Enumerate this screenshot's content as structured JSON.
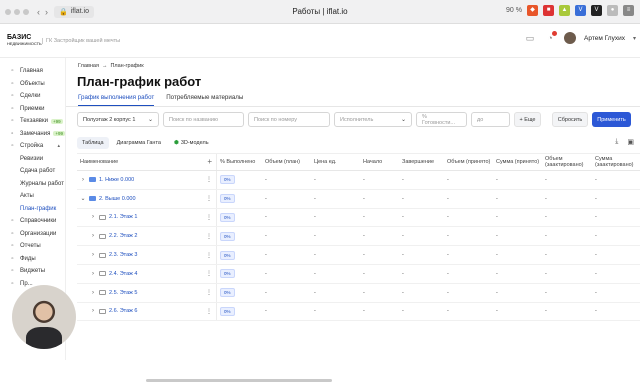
{
  "browser": {
    "url": "iflat.io",
    "window_title": "Работы | iflat.io",
    "zoom": "90 %"
  },
  "header": {
    "logo_main": "БАЗИС",
    "logo_sub": "НЕДВИЖИМОСТЬ",
    "tagline": "ГК Застройщик вашей мечты",
    "user_name": "Артем Глухих"
  },
  "sidebar": {
    "items": [
      {
        "label": "Главная",
        "icon": "home-icon"
      },
      {
        "label": "Объекты",
        "icon": "building-icon"
      },
      {
        "label": "Сделки",
        "icon": "deal-icon"
      },
      {
        "label": "Приемки",
        "icon": "clipboard-icon"
      },
      {
        "label": "Техзаявки",
        "icon": "wrench-icon",
        "badge": "+99"
      },
      {
        "label": "Замечания",
        "icon": "comment-icon",
        "badge": "+99"
      },
      {
        "label": "Стройка",
        "icon": "crane-icon",
        "expanded": true
      },
      {
        "label": "Ревизии",
        "sub": true
      },
      {
        "label": "Сдача работ",
        "sub": true
      },
      {
        "label": "Журналы работ",
        "sub": true
      },
      {
        "label": "Акты",
        "sub": true
      },
      {
        "label": "План-график",
        "sub": true,
        "active": true
      },
      {
        "label": "Справочники",
        "icon": "book-icon"
      },
      {
        "label": "Организации",
        "icon": "org-icon"
      },
      {
        "label": "Отчеты",
        "icon": "report-icon"
      },
      {
        "label": "Фиды",
        "icon": "feed-icon"
      },
      {
        "label": "Виджеты",
        "icon": "widget-icon"
      },
      {
        "label": "Пр...",
        "icon": "gear-icon"
      }
    ]
  },
  "main": {
    "breadcrumb": {
      "home": "Главная",
      "current": "План-график"
    },
    "title": "План-график работ",
    "tabs": [
      {
        "label": "График выполнения работ",
        "active": true
      },
      {
        "label": "Потребляемые материалы",
        "active": false
      }
    ],
    "filters": {
      "section_value": "Полуэтаж 2 корпус 1",
      "name_placeholder": "Поиск по названию",
      "number_placeholder": "Поиск по номеру",
      "executor_placeholder": "Исполнитель",
      "readiness_placeholder": "% Готовности...",
      "to_placeholder": "до",
      "more_label": "+ Еще",
      "reset_label": "Сбросить",
      "apply_label": "Применить"
    },
    "view_tabs": [
      {
        "label": "Таблица",
        "selected": true
      },
      {
        "label": "Диаграмма Ганта",
        "selected": false
      },
      {
        "label": "3D-модель",
        "selected": false
      }
    ],
    "table": {
      "columns": [
        "Наименование",
        "% Выполнено",
        "Объем (план)",
        "Цена ед.",
        "Начало",
        "Завершение",
        "Объем (принято)",
        "Сумма (принято)",
        "Объем (заактировано)",
        "Сумма (заактировано)"
      ],
      "rows": [
        {
          "name": "1. Ниже 0.000",
          "level": 0,
          "expanded": false,
          "folder": "filled",
          "pct": "0%"
        },
        {
          "name": "2. Выше 0.000",
          "level": 0,
          "expanded": true,
          "folder": "filled",
          "pct": "0%"
        },
        {
          "name": "2.1. Этаж 1",
          "level": 1,
          "expanded": false,
          "folder": "empty",
          "pct": "0%"
        },
        {
          "name": "2.2. Этаж 2",
          "level": 1,
          "expanded": false,
          "folder": "empty",
          "pct": "0%"
        },
        {
          "name": "2.3. Этаж 3",
          "level": 1,
          "expanded": false,
          "folder": "empty",
          "pct": "0%"
        },
        {
          "name": "2.4. Этаж 4",
          "level": 1,
          "expanded": false,
          "folder": "empty",
          "pct": "0%"
        },
        {
          "name": "2.5. Этаж 5",
          "level": 1,
          "expanded": false,
          "folder": "empty",
          "pct": "0%"
        },
        {
          "name": "2.6. Этаж 6",
          "level": 1,
          "expanded": false,
          "folder": "empty",
          "pct": "0%"
        }
      ],
      "empty_value": "-"
    }
  },
  "colors": {
    "accent": "#2c58d6",
    "link": "#1e4fbf",
    "badge_green": "#d9f2c8"
  }
}
